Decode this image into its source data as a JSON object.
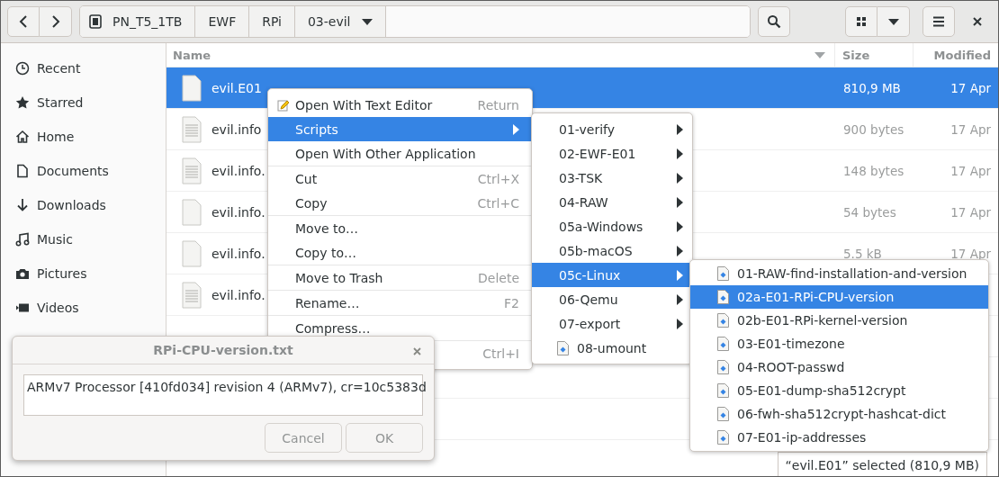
{
  "toolbar": {
    "path": [
      {
        "label": "PN_T5_1TB",
        "kind": "drive"
      },
      {
        "label": "EWF",
        "kind": "folder"
      },
      {
        "label": "RPi",
        "kind": "folder"
      },
      {
        "label": "03-evil",
        "kind": "current"
      }
    ]
  },
  "sidebar": {
    "items": [
      {
        "label": "Recent",
        "kind": "clock"
      },
      {
        "label": "Starred",
        "kind": "star"
      },
      {
        "label": "Home",
        "kind": "home"
      },
      {
        "label": "Documents",
        "kind": "document"
      },
      {
        "label": "Downloads",
        "kind": "download"
      },
      {
        "label": "Music",
        "kind": "music"
      },
      {
        "label": "Pictures",
        "kind": "camera"
      },
      {
        "label": "Videos",
        "kind": "video"
      }
    ]
  },
  "file_list": {
    "columns": [
      "Name",
      "Size",
      "Modified"
    ],
    "rows": [
      {
        "name": "evil.E01",
        "size": "810,9 MB",
        "modified": "17 Apr",
        "kind": "blank",
        "selected": true
      },
      {
        "name": "evil.info",
        "size": "900 bytes",
        "modified": "17 Apr",
        "kind": "text",
        "selected": false
      },
      {
        "name": "evil.info.",
        "size": "148 bytes",
        "modified": "17 Apr",
        "kind": "text",
        "selected": false
      },
      {
        "name": "evil.info.",
        "size": "54 bytes",
        "modified": "17 Apr",
        "kind": "blank",
        "selected": false
      },
      {
        "name": "evil.info.",
        "size": "5.5 kB",
        "modified": "17 Apr",
        "kind": "blank",
        "selected": false
      },
      {
        "name": "evil.info.",
        "kind": "text",
        "selected": false
      }
    ]
  },
  "context_menu": {
    "items": [
      {
        "label": "Open With Text Editor",
        "shortcut": "Return",
        "kind": "editor",
        "selected": false
      },
      {
        "label": "Scripts",
        "kind": "submenu",
        "selected": true
      },
      {
        "label": "Open With Other Application",
        "kind": "item",
        "selected": false
      },
      {
        "kind": "separator"
      },
      {
        "label": "Cut",
        "shortcut": "Ctrl+X",
        "kind": "item",
        "selected": false
      },
      {
        "label": "Copy",
        "shortcut": "Ctrl+C",
        "kind": "item",
        "selected": false
      },
      {
        "kind": "separator"
      },
      {
        "label": "Move to…",
        "kind": "item",
        "selected": false
      },
      {
        "label": "Copy to…",
        "kind": "item",
        "selected": false
      },
      {
        "kind": "separator"
      },
      {
        "label": "Move to Trash",
        "shortcut": "Delete",
        "kind": "item",
        "selected": false
      },
      {
        "kind": "separator"
      },
      {
        "label": "Rename…",
        "shortcut": "F2",
        "kind": "item",
        "selected": false
      },
      {
        "kind": "separator"
      },
      {
        "label": "Compress…",
        "kind": "item",
        "selected": false
      },
      {
        "kind": "separator"
      },
      {
        "shortcut": "Ctrl+I",
        "kind": "item",
        "selected": false
      }
    ]
  },
  "scripts_menu": {
    "items": [
      {
        "label": "01-verify",
        "kind": "folder",
        "selected": false
      },
      {
        "label": "02-EWF-E01",
        "kind": "folder",
        "selected": false
      },
      {
        "label": "03-TSK",
        "kind": "folder",
        "selected": false
      },
      {
        "label": "04-RAW",
        "kind": "folder",
        "selected": false
      },
      {
        "label": "05a-Windows",
        "kind": "folder",
        "selected": false
      },
      {
        "label": "05b-macOS",
        "kind": "folder",
        "selected": false
      },
      {
        "label": "05c-Linux",
        "kind": "folder",
        "selected": true
      },
      {
        "label": "06-Qemu",
        "kind": "folder",
        "selected": false
      },
      {
        "label": "07-export",
        "kind": "folder",
        "selected": false
      },
      {
        "label": "08-umount",
        "kind": "script",
        "selected": false
      }
    ]
  },
  "linux_menu": {
    "items": [
      {
        "label": "01-RAW-find-installation-and-version",
        "kind": "script",
        "selected": false
      },
      {
        "label": "02a-E01-RPi-CPU-version",
        "kind": "script",
        "selected": true
      },
      {
        "label": "02b-E01-RPi-kernel-version",
        "kind": "script",
        "selected": false
      },
      {
        "label": "03-E01-timezone",
        "kind": "script",
        "selected": false
      },
      {
        "label": "04-ROOT-passwd",
        "kind": "script",
        "selected": false
      },
      {
        "label": "05-E01-dump-sha512crypt",
        "kind": "script",
        "selected": false
      },
      {
        "label": "06-fwh-sha512crypt-hashcat-dict",
        "kind": "script",
        "selected": false
      },
      {
        "label": "07-E01-ip-addresses",
        "kind": "script",
        "selected": false
      }
    ]
  },
  "dialog": {
    "title": "RPi-CPU-version.txt",
    "text": "ARMv7 Processor [410fd034] revision 4 (ARMv7), cr=10c5383d",
    "buttons": [
      "Cancel",
      "OK"
    ]
  },
  "status_bar": {
    "text": "“evil.E01” selected  (810,9 MB)"
  }
}
